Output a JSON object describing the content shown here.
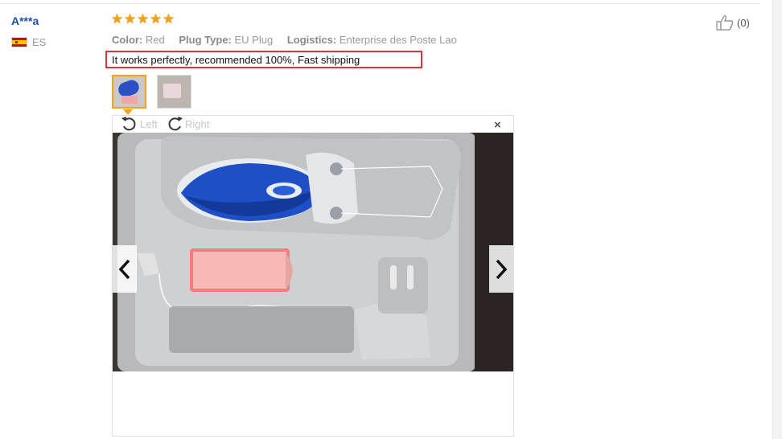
{
  "review": {
    "buyer": {
      "name": "A***a",
      "country_code": "ES",
      "flag_icon": "spain-flag-icon"
    },
    "rating": {
      "stars": 5,
      "max": 5,
      "color": "#f4a11e"
    },
    "attributes": [
      {
        "key": "Color:",
        "value": "Red"
      },
      {
        "key": "Plug Type:",
        "value": "EU Plug"
      },
      {
        "key": "Logistics:",
        "value": "Enterprise des Poste Lao"
      }
    ],
    "feedback_text": "It works perfectly, recommended 100%, Fast shipping",
    "helpful": {
      "icon": "thumbs-up-icon",
      "count_label": "(0)"
    },
    "thumbnails": [
      {
        "name": "product-photo-1",
        "active": true
      },
      {
        "name": "product-photo-2",
        "active": false
      }
    ],
    "viewer": {
      "rotate_left_label": "Left",
      "rotate_right_label": "Right",
      "close_label": "×",
      "prev_icon": "chevron-left-icon",
      "next_icon": "chevron-right-icon"
    }
  },
  "colors": {
    "buyer_link": "#1a4fa3",
    "highlight_border": "#d9363e",
    "active_thumb": "#f3a21d"
  }
}
